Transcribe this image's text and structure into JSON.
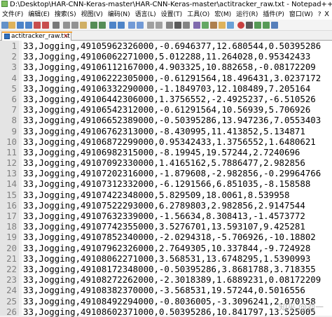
{
  "window": {
    "title": "D:\\Desktop\\HAR-CNN-Keras-master\\HAR-CNN-Keras-master\\actitracker_raw.txt - Notepad++"
  },
  "menu": {
    "items": [
      "文件(F)",
      "编辑(E)",
      "搜索(S)",
      "视图(V)",
      "编码(N)",
      "语言(L)",
      "设置(T)",
      "工具(O)",
      "宏(M)",
      "运行(R)",
      "插件(P)",
      "窗口(W)",
      "?"
    ],
    "close_doc": "X"
  },
  "toolbar": {
    "icons": [
      "new-file-icon",
      "open-file-icon",
      "save-icon",
      "save-all-icon",
      "close-icon",
      "close-all-icon",
      "print-icon",
      "cut-icon",
      "copy-icon",
      "paste-icon",
      "undo-icon",
      "redo-icon",
      "find-icon",
      "replace-icon",
      "zoom-in-icon",
      "zoom-out-icon",
      "sync-v-icon",
      "sync-h-icon",
      "word-wrap-icon",
      "show-all-icon",
      "indent-guide-icon",
      "lang-icon",
      "doc-map-icon",
      "function-list-icon",
      "folder-icon",
      "monitor-icon",
      "record-icon",
      "stop-icon",
      "play-icon",
      "play-multi-icon",
      "save-macro-icon"
    ]
  },
  "tab": {
    "label": "actitracker_raw.txt",
    "close": "✕"
  },
  "editor": {
    "lines": [
      {
        "n": "1",
        "text": "33,Jogging,49105962326000,-0.6946377,12.680544,0.50395286"
      },
      {
        "n": "2",
        "text": "33,Jogging,49106062271000,5.012288,11.264028,0.95342433"
      },
      {
        "n": "3",
        "text": "33,Jogging,49106112167000,4.903325,10.882658,-0.08172209"
      },
      {
        "n": "4",
        "text": "33,Jogging,49106222305000,-0.61291564,18.496431,3.0237172"
      },
      {
        "n": "5",
        "text": "33,Jogging,49106332290000,-1.1849703,12.108489,7.205164"
      },
      {
        "n": "6",
        "text": "33,Jogging,49106442306000,1.3756552,-2.4925237,-6.510526"
      },
      {
        "n": "7",
        "text": "33,Jogging,49106542312000,-0.61291564,10.56939,5.706926"
      },
      {
        "n": "8",
        "text": "33,Jogging,49106652389000,-0.50395286,13.947236,7.0553403"
      },
      {
        "n": "9",
        "text": "33,Jogging,49106762313000,-8.430995,11.413852,5.134871"
      },
      {
        "n": "10",
        "text": "33,Jogging,49106872299000,0.95342433,1.3756552,1.6480621"
      },
      {
        "n": "11",
        "text": "33,Jogging,49106982315000,-8.19945,19.57244,2.7240696"
      },
      {
        "n": "12",
        "text": "33,Jogging,49107092330000,1.4165162,5.7886477,2.982856"
      },
      {
        "n": "13",
        "text": "33,Jogging,49107202316000,-1.879608,-2.982856,-0.29964766"
      },
      {
        "n": "14",
        "text": "33,Jogging,49107312332000,-6.1291566,6.851035,-8.158588"
      },
      {
        "n": "15",
        "text": "33,Jogging,49107422348000,5.829509,18.0061,8.539958"
      },
      {
        "n": "16",
        "text": "33,Jogging,49107522293000,6.2789803,2.982856,2.9147544"
      },
      {
        "n": "17",
        "text": "33,Jogging,49107632339000,-1.56634,8.308413,-1.4573772"
      },
      {
        "n": "18",
        "text": "33,Jogging,49107742355000,3.5276701,13.593107,9.425281"
      },
      {
        "n": "19",
        "text": "33,Jogging,49107852340000,-2.0294318,-5.706926,-10.18802"
      },
      {
        "n": "20",
        "text": "33,Jogging,49107962326000,2.7649305,10.337844,-9.724928"
      },
      {
        "n": "21",
        "text": "33,Jogging,49108062271000,3.568531,13.6748295,1.5390993"
      },
      {
        "n": "22",
        "text": "33,Jogging,49108172348000,-0.50395286,3.8681788,3.718355"
      },
      {
        "n": "23",
        "text": "33,Jogging,49108272262000,-2.3018389,1.6889231,0.08172209"
      },
      {
        "n": "24",
        "text": "33,Jogging,49108382370000,-3.568531,19.57244,0.5016556"
      },
      {
        "n": "25",
        "text": "33,Jogging,49108492294000,-0.8036005,-3.3096241,2.070158"
      },
      {
        "n": "26",
        "text": "33,Jogging,49108602371000,0.50395286,10.841797,13.525005"
      }
    ]
  },
  "watermark": "知乎 @刘一"
}
